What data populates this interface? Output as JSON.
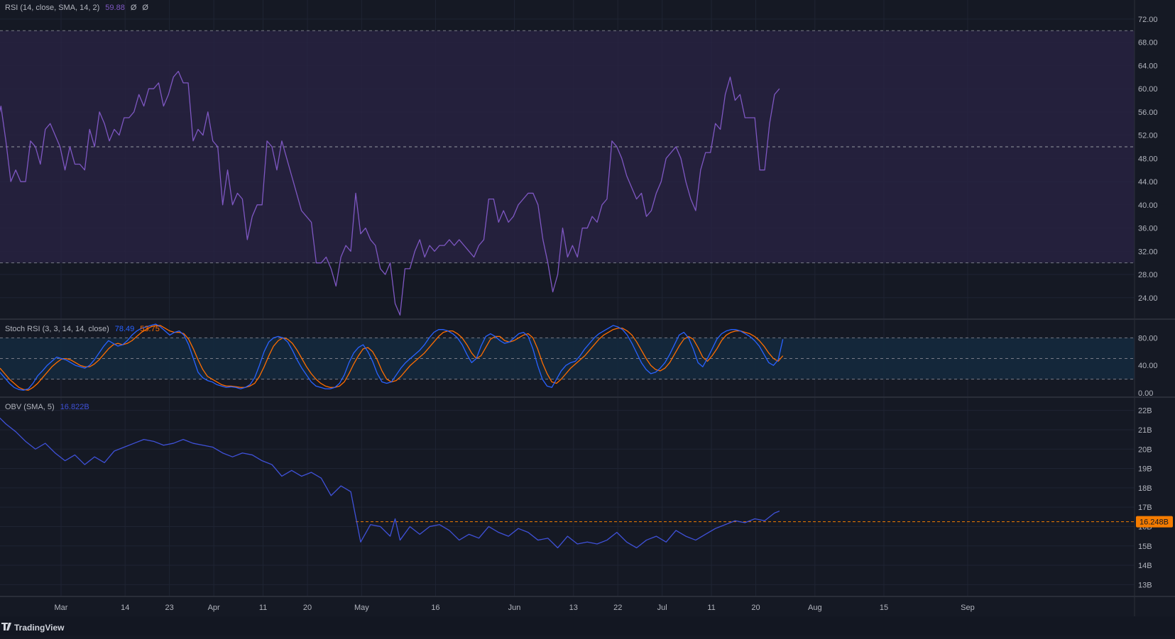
{
  "colors": {
    "background": "#151924",
    "grid": "#1f2433",
    "axis_text": "#b2b5be",
    "rsi_line": "#7e57c2",
    "rsi_band": "#2a2344",
    "rsi_level": "#787b86",
    "rsi_mid": "#9598a1",
    "stoch_k": "#2962ff",
    "stoch_d": "#ff6d00",
    "stoch_band": "#14293d",
    "obv_line": "#3f51d8",
    "obv_level": "#f57c00",
    "pane_border": "#2a2e39"
  },
  "footer": {
    "brand": "TradingView",
    "brand_icon": "tradingview-logo-icon"
  },
  "chart_data": [
    {
      "type": "line",
      "pane": "rsi",
      "title": "RSI (14, close, SMA, 14, 2)",
      "legend_values": [
        "59.88",
        "Ø",
        "Ø"
      ],
      "y_ticks": [
        "72.00",
        "68.00",
        "64.00",
        "60.00",
        "56.00",
        "52.00",
        "48.00",
        "44.00",
        "40.00",
        "36.00",
        "32.00",
        "28.00",
        "24.00"
      ],
      "ylim": [
        20.8,
        74.3
      ],
      "bands": {
        "upper": 70,
        "middle": 50,
        "lower": 30
      },
      "x_days": [
        0,
        1,
        2,
        3,
        4,
        5,
        6,
        7,
        8,
        9,
        10,
        11,
        12,
        13,
        14,
        15,
        16,
        17,
        18,
        19,
        20,
        21,
        22,
        23,
        24,
        25,
        26,
        27,
        28,
        29,
        30,
        31,
        32,
        33,
        34,
        35,
        36,
        37,
        38,
        39,
        40,
        41,
        42,
        43,
        44,
        45,
        46,
        47,
        48,
        49,
        50,
        51,
        52,
        53,
        54,
        55,
        56,
        57,
        58,
        59,
        60,
        61,
        62,
        63,
        64,
        65,
        66,
        67,
        68,
        69,
        70,
        71,
        72,
        73,
        74,
        75,
        76,
        77,
        78,
        79,
        80,
        81,
        82,
        83,
        84,
        85,
        86,
        87,
        88,
        89,
        90,
        91,
        92,
        93,
        94,
        95,
        96,
        97,
        98,
        99,
        100,
        101,
        102,
        103,
        104,
        105,
        106,
        107,
        108,
        109,
        110,
        111,
        112,
        113,
        114,
        115,
        116,
        117,
        118,
        119,
        120,
        121,
        122,
        123,
        124,
        125,
        126,
        127,
        128,
        129,
        130,
        131,
        132,
        133,
        134,
        135,
        136,
        137,
        138,
        139,
        140,
        141,
        142,
        143,
        144,
        145,
        146,
        147,
        148,
        149,
        150,
        151,
        152,
        153,
        154,
        155,
        156,
        157,
        158,
        159
      ],
      "values": [
        53,
        57,
        51,
        44,
        46,
        44,
        44,
        51,
        50,
        47,
        53,
        54,
        52,
        50,
        46,
        50,
        47,
        47,
        46,
        53,
        50,
        56,
        54,
        51,
        53,
        52,
        55,
        55,
        56,
        59,
        57,
        60,
        60,
        61,
        57,
        59,
        62,
        63,
        61,
        61,
        51,
        53,
        52,
        56,
        51,
        50,
        40,
        46,
        40,
        42,
        41,
        34,
        38,
        40,
        40,
        51,
        50,
        46,
        51,
        48,
        45,
        42,
        39,
        38,
        37,
        30,
        30,
        31,
        29,
        26,
        31,
        33,
        32,
        42,
        35,
        36,
        34,
        33,
        29,
        28,
        30,
        23,
        21,
        29,
        29,
        32,
        34,
        31,
        33,
        32,
        33,
        33,
        34,
        33,
        34,
        33,
        32,
        31,
        33,
        34,
        41,
        41,
        37,
        39,
        37,
        38,
        40,
        41,
        42,
        42,
        40,
        34,
        30,
        25,
        28,
        36,
        31,
        33,
        31,
        36,
        36,
        38,
        37,
        40,
        41,
        51,
        50,
        48,
        45,
        43,
        41,
        42,
        38,
        39,
        42,
        44,
        48,
        49,
        50,
        48,
        44,
        41,
        39,
        46,
        49,
        49,
        54,
        53,
        59,
        62,
        58,
        59,
        55,
        55,
        55,
        46,
        46,
        54,
        59,
        60
      ]
    },
    {
      "type": "line",
      "pane": "stoch_rsi",
      "title": "Stoch RSI (3, 3, 14, 14, close)",
      "legend_values": [
        "78.49",
        "53.75"
      ],
      "y_ticks": [
        "80.00",
        "40.00",
        "0.00"
      ],
      "ylim": [
        -2,
        102
      ],
      "bands": {
        "upper": 80,
        "middle": 50,
        "lower": 20
      },
      "series": [
        {
          "label": "K",
          "values": [
            30,
            22,
            14,
            8,
            5,
            4,
            6,
            14,
            25,
            32,
            40,
            46,
            52,
            50,
            48,
            44,
            40,
            38,
            36,
            40,
            48,
            58,
            68,
            76,
            72,
            68,
            70,
            76,
            84,
            90,
            94,
            96,
            98,
            100,
            96,
            90,
            84,
            88,
            90,
            84,
            70,
            50,
            30,
            22,
            18,
            16,
            12,
            10,
            8,
            9,
            8,
            6,
            8,
            12,
            22,
            40,
            60,
            74,
            80,
            82,
            80,
            74,
            62,
            48,
            36,
            26,
            16,
            10,
            8,
            6,
            6,
            8,
            14,
            26,
            44,
            58,
            66,
            70,
            60,
            46,
            28,
            16,
            14,
            16,
            26,
            36,
            44,
            50,
            56,
            62,
            70,
            80,
            88,
            92,
            92,
            90,
            86,
            80,
            70,
            56,
            44,
            50,
            68,
            82,
            86,
            82,
            76,
            72,
            74,
            80,
            86,
            88,
            82,
            64,
            40,
            20,
            10,
            8,
            20,
            32,
            40,
            44,
            46,
            54,
            64,
            72,
            80,
            86,
            90,
            94,
            98,
            96,
            92,
            84,
            72,
            58,
            44,
            34,
            28,
            30,
            36,
            44,
            56,
            70,
            84,
            88,
            80,
            64,
            44,
            38,
            50,
            64,
            78,
            86,
            90,
            92,
            92,
            90,
            86,
            82,
            76,
            68,
            56,
            44,
            40,
            48,
            78
          ],
          "color_key": "stoch_k"
        },
        {
          "label": "D",
          "values": [
            36,
            28,
            20,
            14,
            8,
            5,
            4,
            8,
            14,
            22,
            30,
            38,
            44,
            49,
            50,
            48,
            44,
            40,
            38,
            38,
            42,
            48,
            56,
            64,
            70,
            72,
            70,
            72,
            76,
            82,
            88,
            92,
            96,
            98,
            98,
            94,
            90,
            88,
            88,
            86,
            78,
            64,
            48,
            34,
            24,
            20,
            16,
            12,
            10,
            10,
            9,
            8,
            8,
            10,
            14,
            24,
            38,
            54,
            68,
            76,
            80,
            78,
            72,
            62,
            50,
            38,
            28,
            20,
            14,
            10,
            8,
            8,
            10,
            16,
            28,
            42,
            54,
            64,
            66,
            60,
            48,
            32,
            20,
            16,
            18,
            24,
            32,
            40,
            46,
            52,
            58,
            66,
            74,
            82,
            88,
            90,
            90,
            86,
            80,
            70,
            58,
            50,
            54,
            66,
            78,
            82,
            82,
            76,
            74,
            76,
            80,
            84,
            86,
            80,
            64,
            44,
            28,
            16,
            14,
            20,
            28,
            36,
            42,
            48,
            54,
            62,
            70,
            78,
            84,
            88,
            92,
            94,
            94,
            90,
            84,
            74,
            62,
            50,
            40,
            34,
            32,
            36,
            44,
            56,
            68,
            78,
            82,
            78,
            66,
            52,
            46,
            54,
            64,
            76,
            84,
            88,
            90,
            90,
            88,
            86,
            82,
            76,
            68,
            58,
            50,
            46,
            54
          ],
          "color_key": "stoch_d"
        }
      ]
    },
    {
      "type": "line",
      "pane": "obv",
      "title": "OBV (SMA, 5)",
      "legend_values": [
        "16.822B"
      ],
      "y_ticks": [
        "22B",
        "21B",
        "20B",
        "19B",
        "18B",
        "17B",
        "16B",
        "15B",
        "14B",
        "13B"
      ],
      "ylim": [
        12.5,
        22.5
      ],
      "level": {
        "value": 16.248,
        "label": "16.248B",
        "start_day": 73
      },
      "x_days": [
        0,
        2,
        4,
        6,
        8,
        10,
        12,
        14,
        16,
        18,
        20,
        22,
        24,
        26,
        28,
        30,
        32,
        34,
        36,
        38,
        40,
        42,
        44,
        46,
        48,
        50,
        52,
        54,
        56,
        58,
        60,
        62,
        64,
        66,
        68,
        70,
        72,
        74,
        76,
        78,
        80,
        81,
        82,
        84,
        86,
        88,
        90,
        92,
        94,
        96,
        98,
        100,
        102,
        104,
        106,
        108,
        110,
        112,
        114,
        116,
        118,
        120,
        122,
        124,
        126,
        128,
        130,
        132,
        134,
        136,
        138,
        140,
        142,
        144,
        146,
        148,
        150,
        152,
        154,
        156,
        158,
        159
      ],
      "values": [
        21.8,
        21.3,
        20.9,
        20.4,
        20.0,
        20.3,
        19.8,
        19.4,
        19.7,
        19.2,
        19.6,
        19.3,
        19.9,
        20.1,
        20.3,
        20.5,
        20.4,
        20.2,
        20.3,
        20.5,
        20.3,
        20.2,
        20.1,
        19.8,
        19.6,
        19.8,
        19.7,
        19.4,
        19.2,
        18.6,
        18.9,
        18.6,
        18.8,
        18.5,
        17.6,
        18.1,
        17.8,
        15.2,
        16.1,
        16.0,
        15.5,
        16.4,
        15.3,
        16.0,
        15.6,
        16.0,
        16.1,
        15.8,
        15.3,
        15.6,
        15.4,
        16.0,
        15.7,
        15.5,
        15.9,
        15.7,
        15.3,
        15.4,
        14.9,
        15.5,
        15.1,
        15.2,
        15.1,
        15.3,
        15.7,
        15.2,
        14.9,
        15.3,
        15.5,
        15.2,
        15.8,
        15.5,
        15.3,
        15.6,
        15.9,
        16.1,
        16.3,
        16.2,
        16.4,
        16.3,
        16.7,
        16.8
      ]
    }
  ],
  "x_axis": {
    "labels": [
      {
        "label": "Mar",
        "day": 0
      },
      {
        "label": "14",
        "day": 13
      },
      {
        "label": "23",
        "day": 22
      },
      {
        "label": "Apr",
        "day": 31
      },
      {
        "label": "11",
        "day": 41
      },
      {
        "label": "20",
        "day": 50
      },
      {
        "label": "May",
        "day": 61
      },
      {
        "label": "16",
        "day": 76
      },
      {
        "label": "Jun",
        "day": 92
      },
      {
        "label": "13",
        "day": 104
      },
      {
        "label": "22",
        "day": 113
      },
      {
        "label": "Jul",
        "day": 122
      },
      {
        "label": "11",
        "day": 132
      },
      {
        "label": "20",
        "day": 141
      },
      {
        "label": "Aug",
        "day": 153
      },
      {
        "label": "15",
        "day": 167
      },
      {
        "label": "Sep",
        "day": 184
      }
    ]
  }
}
